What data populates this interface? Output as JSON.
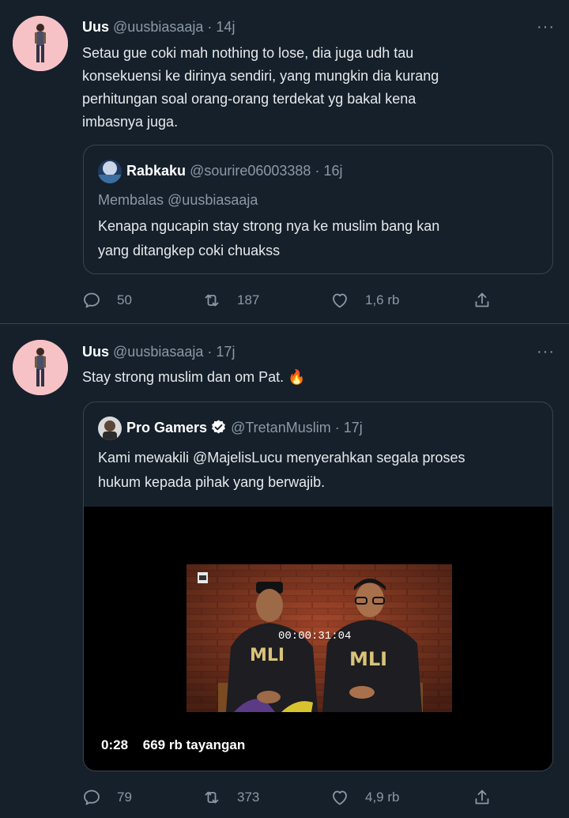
{
  "tweets": [
    {
      "name": "Uus",
      "handle": "@uusbiasaaja",
      "time": "14j",
      "more": "···",
      "lines": [
        "Setau gue coki mah nothing to lose, dia juga udh tau",
        "konsekuensi ke dirinya sendiri, yang mungkin dia kurang",
        "perhitungan soal orang-orang terdekat yg bakal kena",
        "imbasnya juga."
      ],
      "quote": {
        "name": "Rabkaku",
        "handle": "@sourire06003388",
        "time": "16j",
        "reply_to": "Membalas @uusbiasaaja",
        "lines": [
          "Kenapa ngucapin stay strong nya ke muslim bang kan",
          "yang ditangkep coki chuakss"
        ]
      },
      "stats": {
        "replies": "50",
        "retweets": "187",
        "likes": "1,6 rb"
      }
    },
    {
      "name": "Uus",
      "handle": "@uusbiasaaja",
      "time": "17j",
      "more": "···",
      "lines": [
        "Stay strong muslim dan om Pat. 🔥"
      ],
      "quote": {
        "name": "Pro Gamers",
        "handle": "@TretanMuslim",
        "time": "17j",
        "lines": [
          "Kami mewakili @MajelisLucu menyerahkan segala proses",
          "hukum kepada pihak yang berwajib."
        ],
        "video": {
          "timestamp": "00:00:31:04",
          "duration": "0:28",
          "views": "669 rb tayangan",
          "shirt_text": "MLI"
        }
      },
      "stats": {
        "replies": "79",
        "retweets": "373",
        "likes": "4,9 rb"
      }
    }
  ],
  "sep": "·",
  "colors": {
    "background": "#15202b",
    "muted": "#8b98a5",
    "border": "#38444d",
    "verified": "#ffffff"
  },
  "icons": [
    "reply-icon",
    "retweet-icon",
    "like-icon",
    "share-icon",
    "verified-icon",
    "more-icon"
  ]
}
